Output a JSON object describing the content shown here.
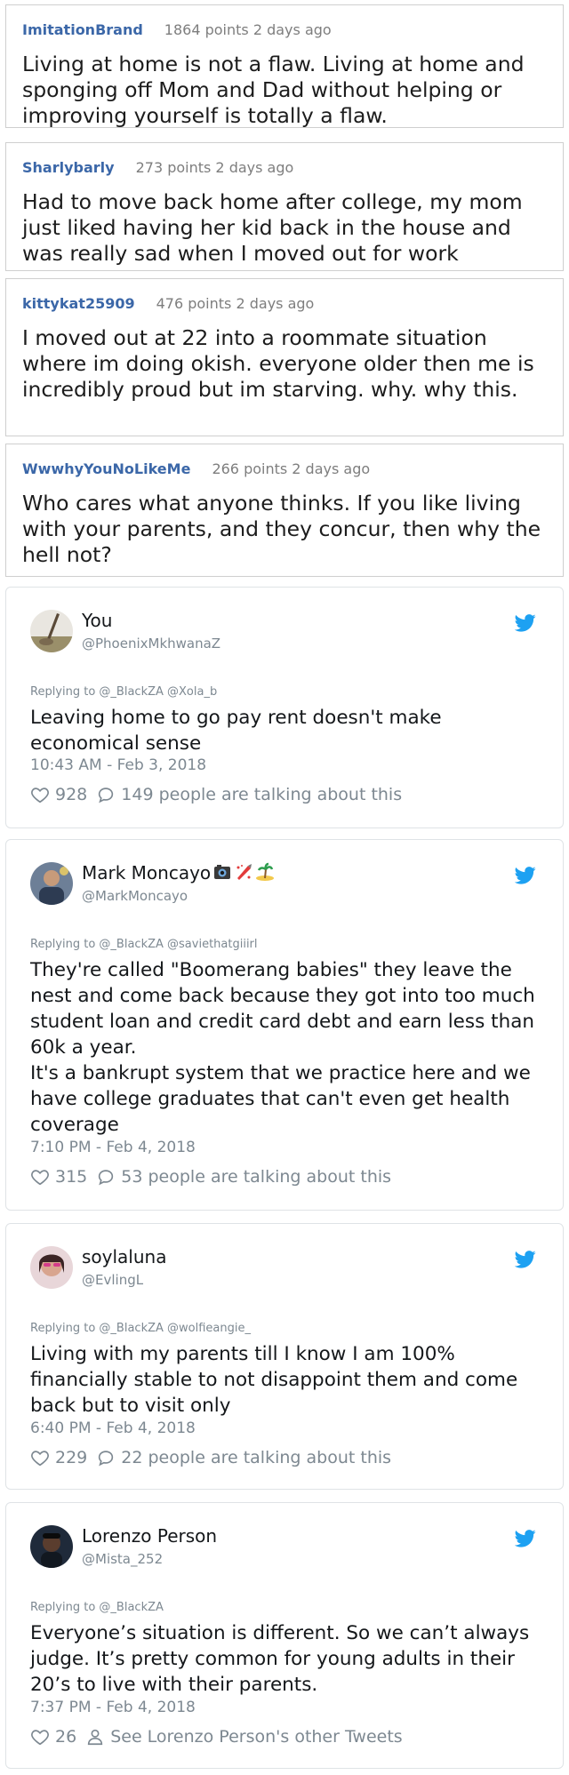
{
  "reddit_comments": [
    {
      "user": "ImitationBrand",
      "meta": "1864 points 2 days ago",
      "body": "Living at home is not a flaw. Living at home and sponging off Mom and Dad without helping or improving yourself is totally a flaw."
    },
    {
      "user": "Sharlybarly",
      "meta": "273 points 2 days ago",
      "body": "Had to move back home after college, my mom just liked having her kid back in the house and was really sad when I moved out for work"
    },
    {
      "user": "kittykat25909",
      "meta": "476 points 2 days ago",
      "body": "I moved out at 22 into a roommate situation where im doing okish. everyone older then me is incredibly proud but im starving. why. why this."
    },
    {
      "user": "WwwhyYouNoLikeMe",
      "meta": "266 points 2 days ago",
      "body": "Who cares what anyone thinks. If you like living with your parents, and they concur, then why the hell not?"
    }
  ],
  "tweets": [
    {
      "name": "You",
      "handle": "@PhoenixMkhwanaZ",
      "reply_to": "Replying to @_BlackZA @Xola_b",
      "text": "Leaving home to go pay rent doesn't make economical sense",
      "time": "10:43 AM - Feb 3, 2018",
      "likes": "928",
      "replies": "149",
      "talking": "people are talking about this"
    },
    {
      "name": "Mark Moncayo",
      "handle": "@MarkMoncayo",
      "reply_to": "Replying to @_BlackZA @saviethatgiiirl",
      "text": "They're called \"Boomerang babies\" they leave the nest and come back because they got into too much student loan and credit card debt and earn less than 60k a year.\nIt's a bankrupt system that we practice here and we have college graduates that can't even get health coverage",
      "time": "7:10 PM - Feb 4, 2018",
      "likes": "315",
      "replies": "53",
      "talking": "people are talking about this",
      "emojis": [
        "camera-emoji",
        "rocket-emoji",
        "island-emoji"
      ]
    },
    {
      "name": "soylaluna",
      "handle": "@EvlingL",
      "reply_to": "Replying to @_BlackZA @wolfieangie_",
      "text": "Living with my parents till I know I am 100% financially stable to not disappoint them and come back but to visit only",
      "time": "6:40 PM - Feb 4, 2018",
      "likes": "229",
      "replies": "22",
      "talking": "people are talking about this"
    },
    {
      "name": "Lorenzo Person",
      "handle": "@Mista_252",
      "reply_to": "Replying to @_BlackZA",
      "text": "Everyone’s situation is different. So we can’t always judge. It’s pretty common for young adults in their 20’s to live with their parents.",
      "time": "7:37 PM - Feb 4, 2018",
      "likes": "26",
      "other_tweets": "See Lorenzo Person's other Tweets"
    }
  ],
  "colors": {
    "reddit_user": "#3b67a8",
    "twitter_blue": "#1da1f2",
    "muted": "#7d8891"
  }
}
